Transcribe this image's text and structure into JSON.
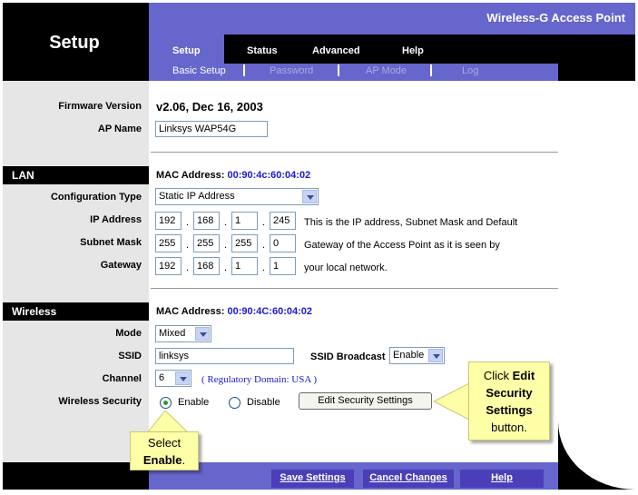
{
  "header": {
    "page_title": "Setup",
    "product_name": "Wireless-G Access Point",
    "tabs": [
      "Setup",
      "Status",
      "Advanced",
      "Help"
    ],
    "subtabs": [
      "Basic Setup",
      "Password",
      "AP Mode",
      "Log"
    ]
  },
  "info": {
    "firmware_label": "Firmware Version",
    "firmware_value": "v2.06, Dec 16, 2003",
    "ap_name_label": "AP Name",
    "ap_name_value": "Linksys WAP54G"
  },
  "lan": {
    "section_label": "LAN",
    "mac_label": "MAC Address:",
    "mac_value": "00:90:4c:60:04:02",
    "config_type_label": "Configuration Type",
    "config_type_value": "Static IP Address",
    "ip_label": "IP Address",
    "ip": [
      "192",
      "168",
      "1",
      "245"
    ],
    "subnet_label": "Subnet Mask",
    "subnet": [
      "255",
      "255",
      "255",
      "0"
    ],
    "gateway_label": "Gateway",
    "gateway": [
      "192",
      "168",
      "1",
      "1"
    ],
    "help_line1": "This is the IP address, Subnet Mask and Default",
    "help_line2": "Gateway of the Access Point as it is seen by",
    "help_line3": "your local network."
  },
  "wireless": {
    "section_label": "Wireless",
    "mac_label": "MAC Address:",
    "mac_value": "00:90:4C:60:04:02",
    "mode_label": "Mode",
    "mode_value": "Mixed",
    "ssid_label": "SSID",
    "ssid_value": "linksys",
    "ssid_broadcast_label": "SSID Broadcast",
    "ssid_broadcast_value": "Enable",
    "channel_label": "Channel",
    "channel_value": "6",
    "regulatory": "( Regulatory Domain: USA )",
    "security_label": "Wireless Security",
    "enable_label": "Enable",
    "disable_label": "Disable",
    "edit_button": "Edit Security Settings"
  },
  "footer": {
    "save": "Save Settings",
    "cancel": "Cancel Changes",
    "help": "Help"
  },
  "callouts": {
    "edit_line1": "Click ",
    "edit_bold1": "Edit",
    "edit_line2": "Security",
    "edit_line3": "Settings",
    "edit_line4": "button.",
    "select_line1": "Select",
    "select_bold": "Enable",
    "select_period": "."
  },
  "colors": {
    "accent": "#6666cc",
    "mac_text": "#1a1ad0",
    "callout_bg": "#ffffa8",
    "radio_on": "#21a121"
  }
}
